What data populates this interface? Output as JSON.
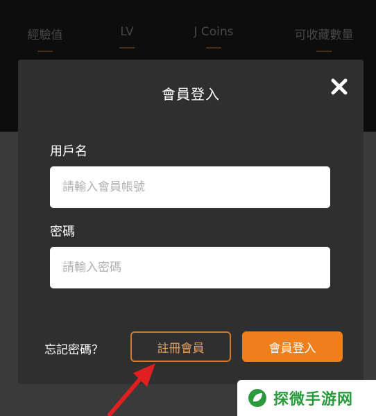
{
  "stats": [
    {
      "label": "經驗值"
    },
    {
      "label": "LV"
    },
    {
      "label": "J Coins"
    },
    {
      "label": "可收藏數量"
    }
  ],
  "modal": {
    "title": "會員登入",
    "username_label": "用戶名",
    "username_placeholder": "請輸入會員帳號",
    "password_label": "密碼",
    "password_placeholder": "請輸入密碼",
    "forgot_label": "忘記密碼？",
    "register_label": "註冊會員",
    "login_label": "會員登入",
    "close_icon": "close-icon"
  },
  "watermark": {
    "text": "探微手游网",
    "brand_color": "#2a9a3c"
  },
  "colors": {
    "accent": "#ef7f1a",
    "modal_bg": "#2f2f2f",
    "arrow": "#e02020"
  }
}
